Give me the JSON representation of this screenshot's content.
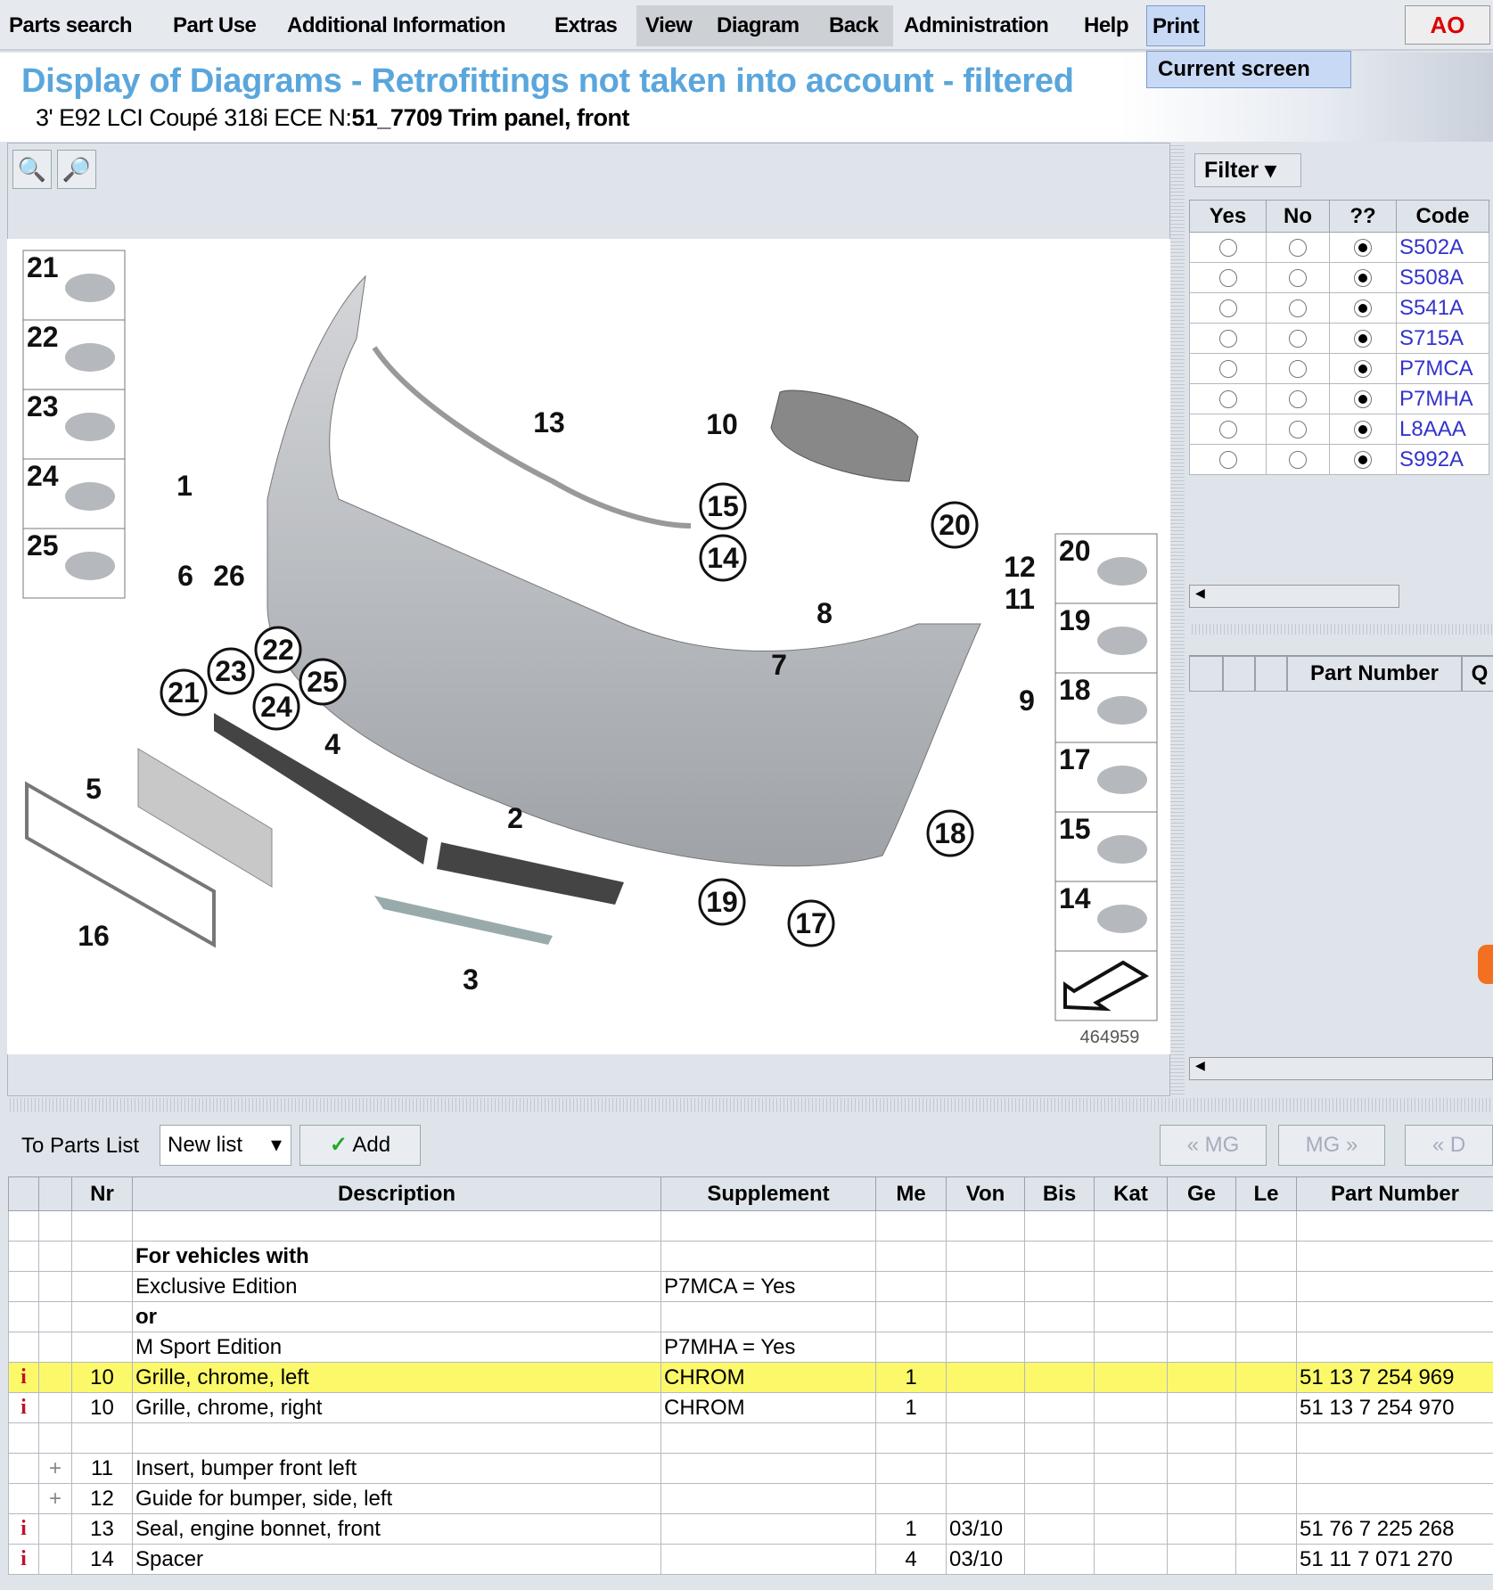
{
  "menu": {
    "items": [
      "Parts search",
      "Part Use",
      "Additional Information",
      "Extras",
      "View",
      "Diagram",
      "Back",
      "Administration",
      "Help",
      "Print"
    ],
    "print_dropdown": "Current screen",
    "logo": "AO"
  },
  "header": {
    "title": "Display of Diagrams - Retrofittings not taken into account - filtered",
    "vehicle": "3' E92 LCI Coupé 318i ECE  N:",
    "group": "51_7709 Trim panel, front"
  },
  "diagram": {
    "zoom_in_icon": "zoom-in-icon",
    "zoom_out_icon": "zoom-out-icon",
    "image_number": "464959",
    "callouts": [
      "1",
      "13",
      "10",
      "15",
      "14",
      "20",
      "12",
      "11",
      "8",
      "7",
      "9",
      "6",
      "26",
      "22",
      "23",
      "25",
      "21",
      "24",
      "4",
      "5",
      "2",
      "18",
      "19",
      "17",
      "16",
      "3"
    ],
    "left_thumbs": [
      "21",
      "22",
      "23",
      "24",
      "25"
    ],
    "right_thumbs": [
      "20",
      "19",
      "18",
      "17",
      "15",
      "14"
    ]
  },
  "filter": {
    "button": "Filter",
    "columns": [
      "Yes",
      "No",
      "??",
      "Code"
    ],
    "rows": [
      {
        "code": "S502A",
        "selected": "??"
      },
      {
        "code": "S508A",
        "selected": "??"
      },
      {
        "code": "S541A",
        "selected": "??"
      },
      {
        "code": "S715A",
        "selected": "??"
      },
      {
        "code": "P7MCA",
        "selected": "??"
      },
      {
        "code": "P7MHA",
        "selected": "??"
      },
      {
        "code": "L8AAA",
        "selected": "??"
      },
      {
        "code": "S992A",
        "selected": "??"
      }
    ],
    "code_color": "#3333cc"
  },
  "parts_panel": {
    "columns": [
      "Part Number",
      "Q"
    ]
  },
  "toolbar": {
    "to_parts_list": "To Parts List",
    "list_select": "New list",
    "add": "Add",
    "prev_mg": "« MG",
    "next_mg": "MG »",
    "prev_d": "« D"
  },
  "parts_table": {
    "columns": [
      "",
      "",
      "Nr",
      "Description",
      "Supplement",
      "Me",
      "Von",
      "Bis",
      "Kat",
      "Ge",
      "Le",
      "Part Number"
    ],
    "highlight_color": "#fbf96a",
    "rows": [
      {
        "icon": "",
        "mark": "",
        "nr": "",
        "desc": "",
        "supp": "",
        "me": "",
        "von": "",
        "pn": ""
      },
      {
        "icon": "",
        "mark": "",
        "nr": "",
        "desc": "For vehicles with",
        "bold": true,
        "supp": "",
        "me": "",
        "von": "",
        "pn": ""
      },
      {
        "icon": "",
        "mark": "",
        "nr": "",
        "desc": "Exclusive Edition",
        "supp": "P7MCA = Yes",
        "me": "",
        "von": "",
        "pn": ""
      },
      {
        "icon": "",
        "mark": "",
        "nr": "",
        "desc": "or",
        "bold": true,
        "supp": "",
        "me": "",
        "von": "",
        "pn": ""
      },
      {
        "icon": "",
        "mark": "",
        "nr": "",
        "desc": "M Sport Edition",
        "supp": "P7MHA = Yes",
        "me": "",
        "von": "",
        "pn": ""
      },
      {
        "icon": "i",
        "mark": "",
        "nr": "10",
        "desc": "Grille, chrome, left",
        "supp": "CHROM",
        "me": "1",
        "von": "",
        "pn": "51 13 7 254 969",
        "highlight": true
      },
      {
        "icon": "i",
        "mark": "",
        "nr": "10",
        "desc": "Grille, chrome, right",
        "supp": "CHROM",
        "me": "1",
        "von": "",
        "pn": "51 13 7 254 970"
      },
      {
        "icon": "",
        "mark": "",
        "nr": "",
        "desc": "",
        "supp": "",
        "me": "",
        "von": "",
        "pn": ""
      },
      {
        "icon": "",
        "mark": "+",
        "nr": "11",
        "desc": "Insert, bumper front left",
        "supp": "",
        "me": "",
        "von": "",
        "pn": ""
      },
      {
        "icon": "",
        "mark": "+",
        "nr": "12",
        "desc": "Guide for bumper, side, left",
        "supp": "",
        "me": "",
        "von": "",
        "pn": ""
      },
      {
        "icon": "i",
        "mark": "",
        "nr": "13",
        "desc": "Seal, engine bonnet, front",
        "supp": "",
        "me": "1",
        "von": "03/10",
        "pn": "51 76 7 225 268"
      },
      {
        "icon": "i",
        "mark": "",
        "nr": "14",
        "desc": "Spacer",
        "supp": "",
        "me": "4",
        "von": "03/10",
        "pn": "51 11 7 071 270"
      }
    ]
  }
}
